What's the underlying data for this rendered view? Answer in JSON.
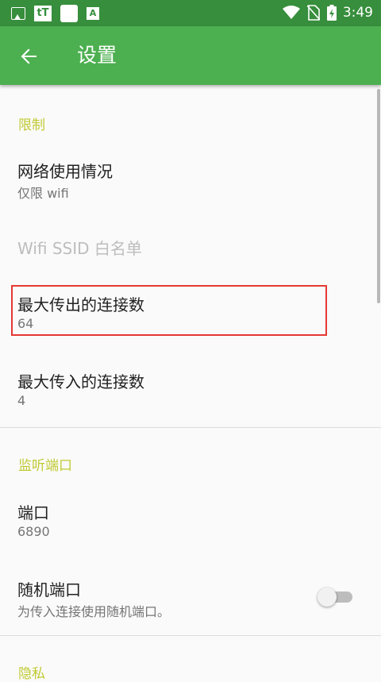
{
  "status_bar": {
    "time": "3:49",
    "icons": [
      "image-icon",
      "tt-icon",
      "square-icon",
      "a-icon",
      "wifi-icon",
      "no-sim-icon",
      "battery-charging-icon"
    ],
    "tt_label": "tT",
    "a_label": "A"
  },
  "app_bar": {
    "title": "设置",
    "back_icon": "arrow-back-icon",
    "color": "#4caf50"
  },
  "sections": {
    "limits": {
      "header": "限制",
      "network_usage": {
        "title": "网络使用情况",
        "summary": "仅限 wifi"
      },
      "wifi_whitelist": {
        "title": "Wifi SSID 白名单"
      },
      "max_outgoing": {
        "title": "最大传出的连接数",
        "summary": "64"
      },
      "max_incoming": {
        "title": "最大传入的连接数",
        "summary": "4"
      }
    },
    "listen_port": {
      "header": "监听端口",
      "port": {
        "title": "端口",
        "summary": "6890"
      },
      "random_port": {
        "title": "随机端口",
        "summary": "为传入连接使用随机端口。",
        "enabled": false
      }
    },
    "privacy": {
      "header": "隐私"
    }
  },
  "colors": {
    "accent": "#c0ca33",
    "status_bar": "#378e3c",
    "highlight": "#e53935"
  }
}
